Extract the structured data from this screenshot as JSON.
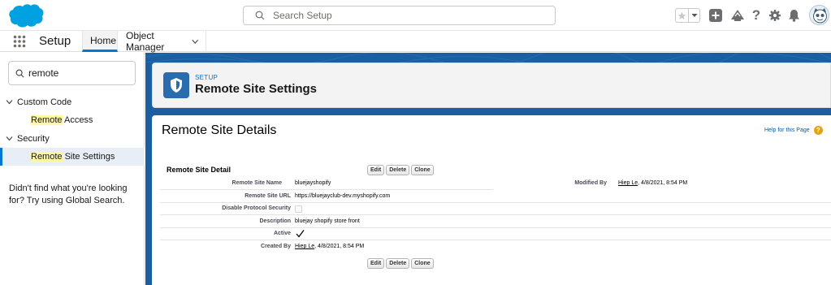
{
  "header": {
    "search_placeholder": "Search Setup",
    "icons": [
      "salesforce-logo",
      "search-icon",
      "star-icon",
      "chevron-down-icon",
      "plus-icon",
      "trailhead-icon",
      "help-icon",
      "gear-icon",
      "bell-icon",
      "avatar"
    ]
  },
  "app_nav": {
    "app_name": "Setup",
    "tabs": [
      {
        "label": "Home",
        "active": true
      },
      {
        "label": "Object Manager",
        "active": false
      }
    ]
  },
  "sidebar": {
    "quickfind_value": "remote",
    "tree": [
      {
        "group": "Custom Code",
        "items": [
          {
            "highlight": "Remote",
            "rest": " Access"
          }
        ]
      },
      {
        "group": "Security",
        "items": [
          {
            "highlight": "Remote",
            "rest": " Site Settings",
            "selected": true
          }
        ]
      }
    ],
    "not_found_text": "Didn't find what you're looking for? Try using Global Search."
  },
  "page_header": {
    "breadcrumb": "SETUP",
    "title": "Remote Site Settings"
  },
  "content": {
    "section_title": "Remote Site Details",
    "help_link": "Help for this Page",
    "detail_title": "Remote Site Detail",
    "buttons": {
      "edit": "Edit",
      "delete": "Delete",
      "clone": "Clone"
    },
    "fields": {
      "remote_site_name": {
        "label": "Remote Site Name",
        "value": "bluejayshopify"
      },
      "remote_site_url": {
        "label": "Remote Site URL",
        "value": "https://bluejayclub-dev.myshopify.com"
      },
      "disable_protocol_security": {
        "label": "Disable Protocol Security",
        "checked": false
      },
      "description": {
        "label": "Description",
        "value": "bluejay shopify store front"
      },
      "active": {
        "label": "Active",
        "checked": true
      },
      "created_by": {
        "label": "Created By",
        "user": "Hiep Le",
        "date": ", 4/8/2021, 8:54 PM"
      },
      "modified_by": {
        "label": "Modified By",
        "user": "Hiep Le",
        "date": ", 4/8/2021, 8:54 PM"
      }
    }
  },
  "colors": {
    "brand_blue": "#0176d3",
    "header_band": "#1b5fa0",
    "highlight": "#fff7a6"
  }
}
